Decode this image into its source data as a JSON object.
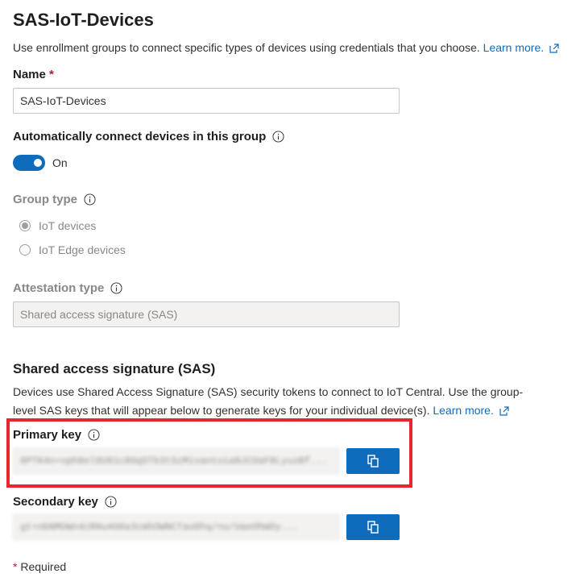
{
  "page": {
    "title": "SAS-IoT-Devices",
    "description": "Use enrollment groups to connect specific types of devices using credentials that you choose.",
    "learn_more": "Learn more."
  },
  "name_field": {
    "label": "Name",
    "required_mark": "*",
    "value": "SAS-IoT-Devices"
  },
  "auto_connect": {
    "label": "Automatically connect devices in this group",
    "toggle_state": "On"
  },
  "group_type": {
    "label": "Group type",
    "options": [
      {
        "label": "IoT devices",
        "selected": true
      },
      {
        "label": "IoT Edge devices",
        "selected": false
      }
    ]
  },
  "attestation": {
    "label": "Attestation type",
    "value": "Shared access signature (SAS)"
  },
  "sas_section": {
    "heading": "Shared access signature (SAS)",
    "description_line1": "Devices use Shared Access Signature (SAS) security tokens to connect to IoT Central. Use the group-",
    "description_line2": "level SAS keys that will appear below to generate keys for your individual device(s).",
    "learn_more": "Learn more."
  },
  "primary_key": {
    "label": "Primary key",
    "value": "6PTK4n+oph8el9U91c8GqSTb3tSzMivantoiaNJCOaF8LyuzBf..."
  },
  "secondary_key": {
    "label": "Secondary key",
    "value": "gt+nbNMUWn4cRHu4G0a3cmhOWNCTaoDhq/nu/UaeOhWOy..."
  },
  "footer": {
    "required_mark": "*",
    "required_text": "Required"
  },
  "colors": {
    "accent": "#0f6cbd",
    "highlight": "#e8272c",
    "required": "#a4262c"
  }
}
